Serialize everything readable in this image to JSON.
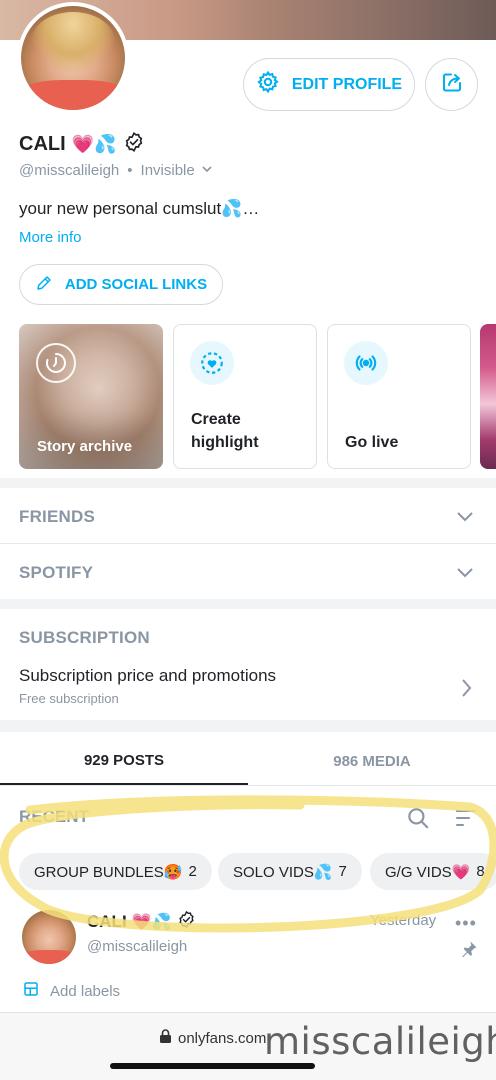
{
  "profile": {
    "name": "CALI",
    "name_emoji": "💗💦",
    "handle": "@misscalileigh",
    "status": "Invisible",
    "bio": "your new personal cumslut💦…",
    "more_info": "More info"
  },
  "actions": {
    "edit_profile": "EDIT PROFILE",
    "add_social_links": "ADD SOCIAL LINKS"
  },
  "stories": {
    "archive": "Story archive",
    "create_line1": "Create",
    "create_line2": "highlight",
    "go_live": "Go live"
  },
  "sections": {
    "friends": "FRIENDS",
    "spotify": "SPOTIFY",
    "subscription": "SUBSCRIPTION",
    "sub_title": "Subscription price and promotions",
    "sub_subtitle": "Free subscription"
  },
  "tabs": {
    "posts": "929 POSTS",
    "media": "986 MEDIA"
  },
  "recent": {
    "label": "RECENT",
    "chips": [
      {
        "label": "GROUP BUNDLES🥵",
        "count": "2"
      },
      {
        "label": "SOLO VIDS💦",
        "count": "7"
      },
      {
        "label": "G/G VIDS💗",
        "count": "8"
      }
    ]
  },
  "post": {
    "author": "CALI",
    "author_emoji": "💗💦",
    "handle": "@misscalileigh",
    "time": "Yesterday",
    "more": "•••",
    "add_labels": "Add labels"
  },
  "browser": {
    "url": "onlyfans.com"
  },
  "watermark": "misscalileigh",
  "colors": {
    "accent": "#00aff0",
    "muted": "#8a96a3",
    "highlight_marker": "#f5e07a"
  },
  "icons": {
    "edit_profile": "gear-icon",
    "share": "share-icon",
    "verified": "verified-badge-icon",
    "social": "pencil-icon",
    "archive": "clock-history-icon",
    "create_highlight": "heart-circle-icon",
    "go_live": "broadcast-icon",
    "chevron": "chevron-down-icon",
    "chevron_right": "chevron-right-icon",
    "search": "search-icon",
    "sort": "sort-icon",
    "pin": "pin-icon",
    "labels": "label-icon",
    "lock": "lock-icon"
  }
}
